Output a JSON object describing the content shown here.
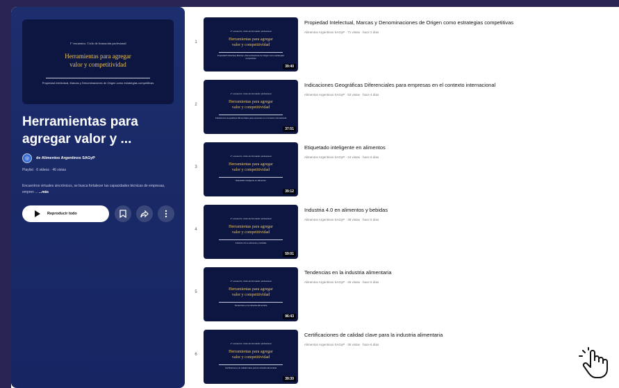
{
  "playlist": {
    "thumb_small": "1° encuentro. Ciclo de formación profesional",
    "thumb_big_1": "Herramientas para agregar",
    "thumb_big_2": "valor y competitividad",
    "thumb_sub": "Propiedad Intelectual, Marcas y Denominaciones de Origen como estrategias competitivas",
    "title_1": "Herramientas para",
    "title_2": "agregar valor y ...",
    "owner": "de Alimentos Argentinos SAGyP",
    "meta": "Playlist · 6 videos · 46 vistas",
    "description": "Encuentros virtuales sincrónicos, se busca fortalecer las capacidades técnicas de empresas, empren ...",
    "more_label": "...más",
    "play_all_label": "Reproducir todo",
    "save_icon": "bookmark-icon",
    "share_icon": "share-icon",
    "more_icon": "more-vert-icon"
  },
  "videos": [
    {
      "index": "1",
      "title": "Propiedad Intelectual, Marcas y Denominaciones de Origen como estrategias competitivas",
      "meta": "Alimentos Argentinos SAGyP · 71 vistas · hace 2 días",
      "duration": "39:40",
      "thumb_sub": "Propiedad Intelectual, Marcas y Denominaciones de Origen como estrategias competitivas"
    },
    {
      "index": "2",
      "title": "Indicaciones Geográficas Diferenciales para empresas en el contexto internacional",
      "meta": "Alimentos Argentinos SAGyP · 53 vistas · hace 4 días",
      "duration": "37:51",
      "thumb_sub": "Indicaciones Geográficas Diferenciales para empresas en el contexto internacional"
    },
    {
      "index": "3",
      "title": "Etiquetado inteligente en alimentos",
      "meta": "Alimentos Argentinos SAGyP · 24 vistas · hace 5 días",
      "duration": "39:12",
      "thumb_sub": "Etiquetado inteligente en alimentos"
    },
    {
      "index": "4",
      "title": "Industria 4.0 en alimentos y bebidas",
      "meta": "Alimentos Argentinos SAGyP · 38 vistas · hace 5 días",
      "duration": "59:01",
      "thumb_sub": "Industria 4.0 en alimentos y bebidas"
    },
    {
      "index": "5",
      "title": "Tendencias en la industria alimentaria",
      "meta": "Alimentos Argentinos SAGyP · 45 vistas · hace 5 días",
      "duration": "96:43",
      "thumb_sub": "Tendencias en la industria alimentaria"
    },
    {
      "index": "6",
      "title": "Certificaciones de calidad clave para la industria alimentaria",
      "meta": "Alimentos Argentinos SAGyP · 36 vistas · hace 6 días",
      "duration": "39:30",
      "thumb_sub": "Certificaciones de calidad clave para la industria alimentaria"
    }
  ],
  "colors": {
    "sidebar": "#1a2a67",
    "accent": "#e7c36a",
    "outer": "#2a2452"
  },
  "cursor_icon": "hand-pointer-icon"
}
